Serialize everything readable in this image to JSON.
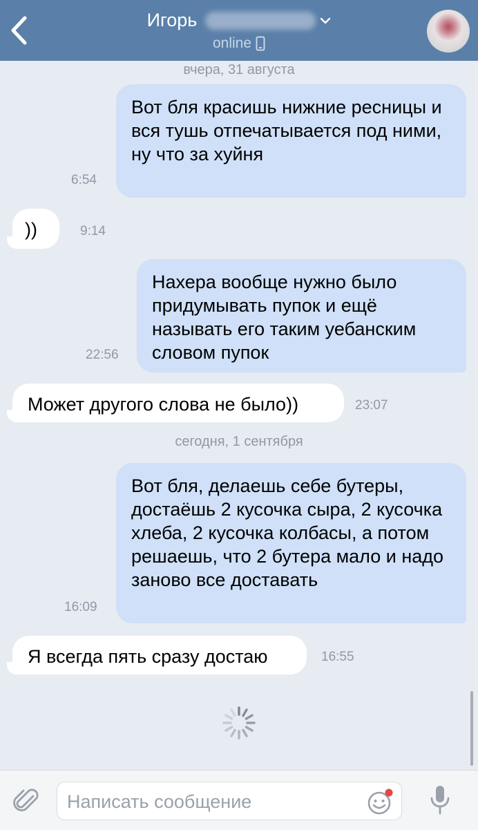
{
  "header": {
    "contact_name": "Игорь",
    "status": "online"
  },
  "messages": [
    {
      "type": "date",
      "text": "вчера, 31 августа"
    },
    {
      "type": "out",
      "text": "Вот бля красишь нижние ресницы и вся тушь отпечатывается под ними, ну что за хуйня",
      "time": "6:54"
    },
    {
      "type": "in",
      "text": "))",
      "time": "9:14"
    },
    {
      "type": "out",
      "text": "Нахера вообще нужно было придумывать пупок и ещё называть его таким уебанским словом пупок",
      "time": "22:56"
    },
    {
      "type": "in",
      "text": "Может другого слова не было))",
      "time": "23:07"
    },
    {
      "type": "date",
      "text": "сегодня, 1 сентября"
    },
    {
      "type": "out",
      "text": "Вот бля, делаешь себе бутеры, достаёшь 2 кусочка сыра, 2 кусочка хлеба, 2 кусочка колбасы, а потом решаешь, что 2 бутера мало и надо заново все доставать",
      "time": "16:09"
    },
    {
      "type": "in",
      "text": "Я всегда пять сразу достаю",
      "time": "16:55"
    }
  ],
  "composer": {
    "placeholder": "Написать сообщение"
  },
  "colors": {
    "header_bg": "#5a7fa9",
    "chat_bg": "#e7ebf2",
    "outgoing_bubble": "#cfe0f8",
    "incoming_bubble": "#ffffff",
    "timestamp": "#8f9aa6",
    "notification_dot": "#e64646"
  },
  "icons": [
    "back-arrow-icon",
    "chevron-down-icon",
    "mobile-phone-icon",
    "avatar",
    "loading-spinner-icon",
    "paperclip-icon",
    "emoji-icon",
    "microphone-icon"
  ]
}
